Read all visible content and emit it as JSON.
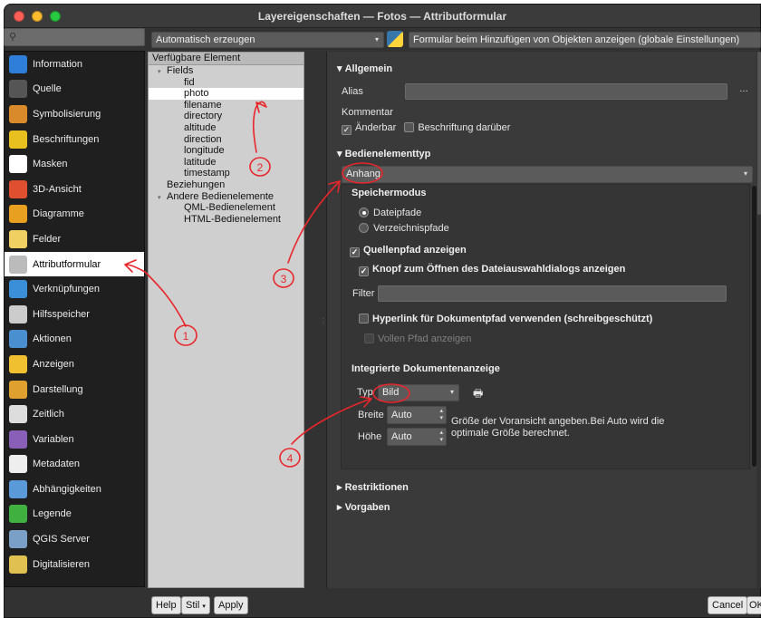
{
  "window": {
    "title": "Layereigenschaften — Fotos — Attributformular"
  },
  "search": {
    "placeholder": ""
  },
  "sidebar": {
    "items": [
      {
        "label": "Information",
        "icon": "info-icon",
        "color": "#2f7fd8"
      },
      {
        "label": "Quelle",
        "icon": "source-icon",
        "color": "#555"
      },
      {
        "label": "Symbolisierung",
        "icon": "paintbrush-icon",
        "color": "#d98a2b"
      },
      {
        "label": "Beschriftungen",
        "icon": "labels-icon",
        "color": "#e8c020"
      },
      {
        "label": "Masken",
        "icon": "masks-icon",
        "color": "#ffffff"
      },
      {
        "label": "3D-Ansicht",
        "icon": "3d-cube-icon",
        "color": "#e05030"
      },
      {
        "label": "Diagramme",
        "icon": "diagram-icon",
        "color": "#e8a020"
      },
      {
        "label": "Felder",
        "icon": "fields-icon",
        "color": "#f0d060"
      },
      {
        "label": "Attributformular",
        "icon": "form-icon",
        "color": "#bbbbbb"
      },
      {
        "label": "Verknüpfungen",
        "icon": "joins-icon",
        "color": "#3b8fd8"
      },
      {
        "label": "Hilfsspeicher",
        "icon": "storage-icon",
        "color": "#cccccc"
      },
      {
        "label": "Aktionen",
        "icon": "actions-gear-icon",
        "color": "#4a90d0"
      },
      {
        "label": "Anzeigen",
        "icon": "display-bubble-icon",
        "color": "#f0c030"
      },
      {
        "label": "Darstellung",
        "icon": "rendering-brush-icon",
        "color": "#e0a030"
      },
      {
        "label": "Zeitlich",
        "icon": "clock-icon",
        "color": "#dddddd"
      },
      {
        "label": "Variablen",
        "icon": "variables-icon",
        "color": "#8a5fb8"
      },
      {
        "label": "Metadaten",
        "icon": "metadata-icon",
        "color": "#eeeeee"
      },
      {
        "label": "Abhängigkeiten",
        "icon": "dependencies-icon",
        "color": "#5a9ad8"
      },
      {
        "label": "Legende",
        "icon": "legend-icon",
        "color": "#40b040"
      },
      {
        "label": "QGIS Server",
        "icon": "qgis-server-icon",
        "color": "#7aa0c8"
      },
      {
        "label": "Digitalisieren",
        "icon": "digitize-icon",
        "color": "#e0c050"
      }
    ],
    "selected_index": 8
  },
  "toolbar": {
    "layout_combo": "Automatisch erzeugen",
    "form_combo": "Formular beim Hinzufügen von Objekten anzeigen (globale Einstellungen)"
  },
  "tree": {
    "header": "Verfügbare Element",
    "rows": [
      {
        "label": "Fields",
        "level": 1,
        "expander": "▾"
      },
      {
        "label": "fid",
        "level": 2
      },
      {
        "label": "photo",
        "level": 2,
        "selected": true
      },
      {
        "label": "filename",
        "level": 2
      },
      {
        "label": "directory",
        "level": 2
      },
      {
        "label": "altitude",
        "level": 2
      },
      {
        "label": "direction",
        "level": 2
      },
      {
        "label": "longitude",
        "level": 2
      },
      {
        "label": "latitude",
        "level": 2
      },
      {
        "label": "timestamp",
        "level": 2
      },
      {
        "label": "Beziehungen",
        "level": 1
      },
      {
        "label": "Andere Bedienelemente",
        "level": 1,
        "expander": "▾"
      },
      {
        "label": "QML-Bedienelement",
        "level": 2
      },
      {
        "label": "HTML-Bedienelement",
        "level": 2
      }
    ]
  },
  "general": {
    "section": "Allgemein",
    "alias_label": "Alias",
    "alias_value": "",
    "expr_button": "…",
    "comment_label": "Kommentar",
    "editable_label": "Änderbar",
    "label_on_top": "Beschriftung darüber"
  },
  "widget_type": {
    "section": "Bedienelementtyp",
    "value": "Anhang"
  },
  "storage": {
    "title": "Speichermodus",
    "options": [
      "Dateipfade",
      "Verzeichnispfade"
    ],
    "selected": 0,
    "show_source_path": "Quellenpfad anzeigen",
    "show_open_button": "Knopf zum Öffnen des Dateiauswahldialogs anzeigen",
    "filter_label": "Filter",
    "filter_value": "",
    "hyperlink_label": "Hyperlink für Dokumentpfad verwenden (schreibgeschützt)",
    "full_path_label": "Vollen Pfad anzeigen"
  },
  "viewer": {
    "title": "Integrierte Dokumentenanzeige",
    "type_label": "Typ",
    "type_value": "Bild",
    "width_label": "Breite",
    "width_value": "Auto",
    "height_label": "Höhe",
    "height_value": "Auto",
    "hint": "Größe der Voransicht angeben.Bei Auto wird die optimale Größe berechnet."
  },
  "collapsed": {
    "constraints": "Restriktionen",
    "defaults": "Vorgaben"
  },
  "buttons": {
    "help": "Help",
    "style": "Stil",
    "apply": "Apply",
    "cancel": "Cancel",
    "ok": "OK"
  },
  "annotations": {
    "color": "#e8262b",
    "numbers": [
      "1",
      "2",
      "3",
      "4"
    ]
  }
}
